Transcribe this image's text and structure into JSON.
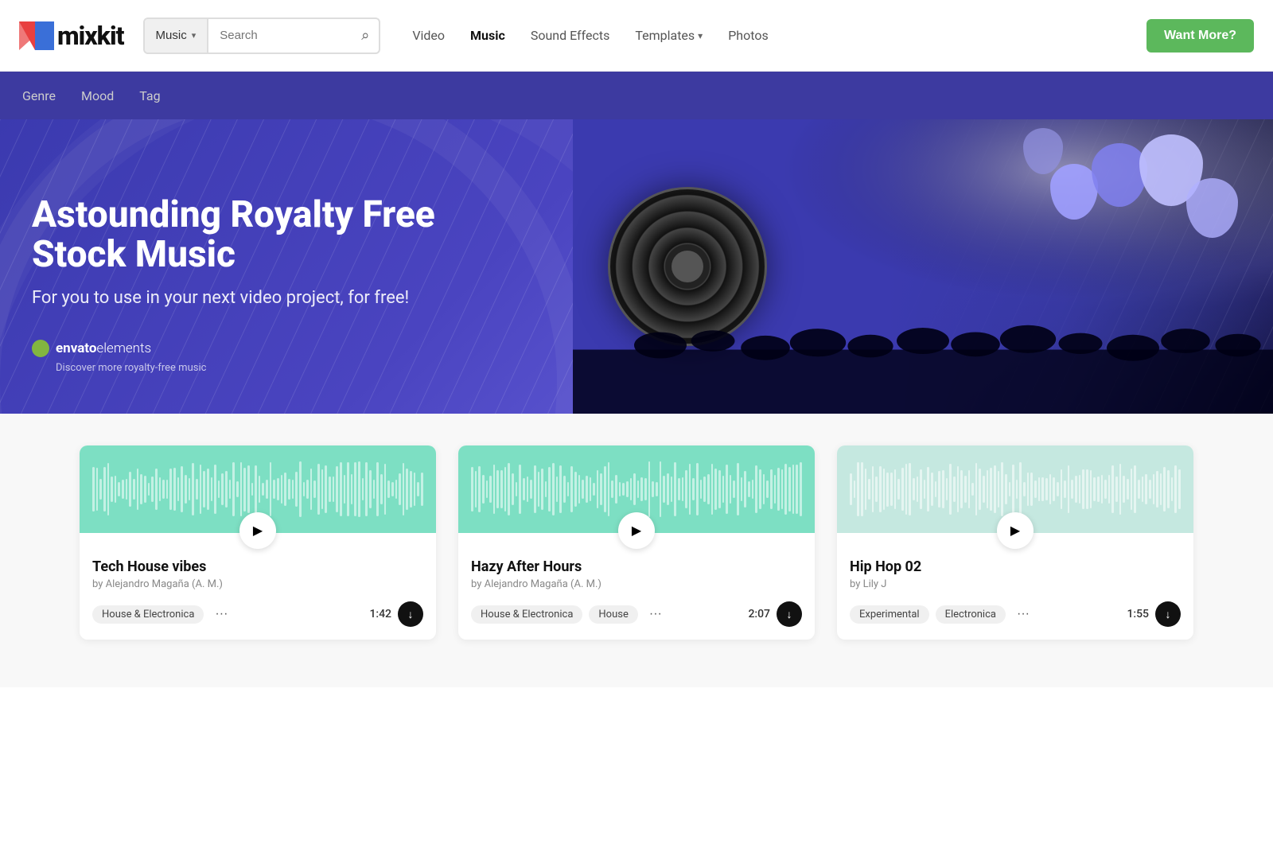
{
  "header": {
    "logo_text": "mixkit",
    "search_type": "Music",
    "search_placeholder": "Search",
    "nav": [
      {
        "id": "video",
        "label": "Video",
        "active": false
      },
      {
        "id": "music",
        "label": "Music",
        "active": true
      },
      {
        "id": "sound-effects",
        "label": "Sound Effects",
        "active": false
      },
      {
        "id": "templates",
        "label": "Templates",
        "active": false,
        "has_dropdown": true
      },
      {
        "id": "photos",
        "label": "Photos",
        "active": false
      }
    ],
    "cta_label": "Want More?"
  },
  "filter_bar": {
    "items": [
      {
        "id": "genre",
        "label": "Genre"
      },
      {
        "id": "mood",
        "label": "Mood"
      },
      {
        "id": "tag",
        "label": "Tag"
      }
    ]
  },
  "banner": {
    "title": "Astounding Royalty Free Stock Music",
    "subtitle": "For you to use in your next video project, for free!",
    "envato_name": "envatoelements",
    "envato_tagline": "Discover more royalty-free music"
  },
  "cards": [
    {
      "id": "card-1",
      "title": "Tech House vibes",
      "author": "by Alejandro Magaña (A. M.)",
      "tags": [
        "House & Electronica"
      ],
      "duration": "1:42",
      "waveform_color": "green"
    },
    {
      "id": "card-2",
      "title": "Hazy After Hours",
      "author": "by Alejandro Magaña (A. M.)",
      "tags": [
        "House & Electronica",
        "House"
      ],
      "duration": "2:07",
      "waveform_color": "green"
    },
    {
      "id": "card-3",
      "title": "Hip Hop 02",
      "author": "by Lily J",
      "tags": [
        "Experimental",
        "Electronica"
      ],
      "duration": "1:55",
      "waveform_color": "light-blue"
    }
  ],
  "icons": {
    "chevron_down": "▾",
    "search": "🔍",
    "play": "▶",
    "download": "↓",
    "more": "···",
    "envato_dot": "●"
  }
}
